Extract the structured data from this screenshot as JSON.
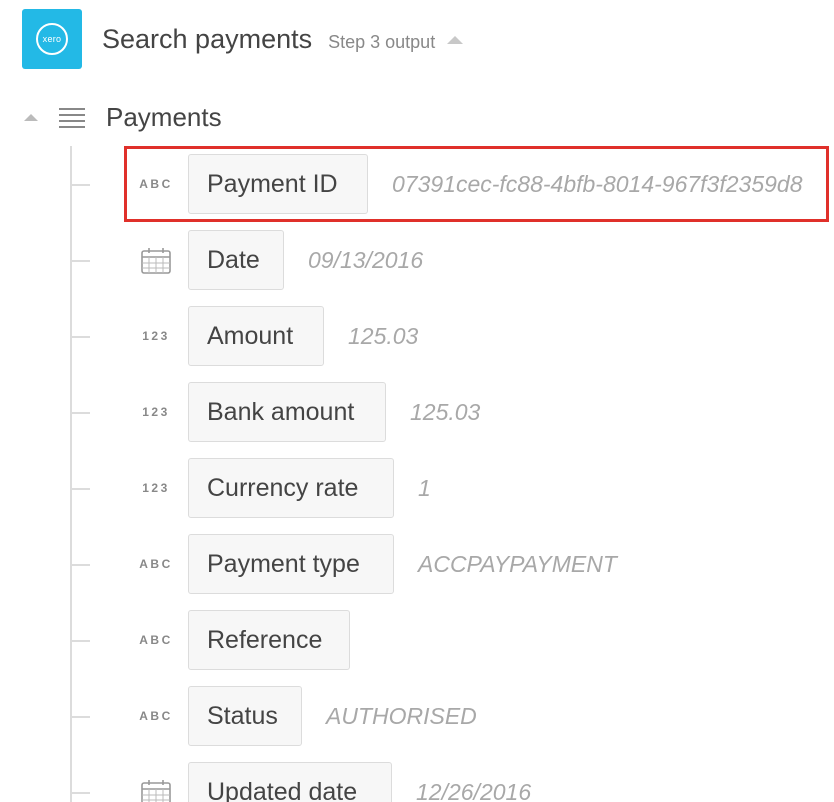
{
  "header": {
    "logo_text": "xero",
    "title": "Search payments",
    "subtitle": "Step 3 output"
  },
  "section": {
    "title": "Payments"
  },
  "fields": [
    {
      "type": "ABC",
      "label": "Payment ID",
      "value": "07391cec-fc88-4bfb-8014-967f3f2359d8"
    },
    {
      "type": "date",
      "label": "Date",
      "value": "09/13/2016"
    },
    {
      "type": "123",
      "label": "Amount",
      "value": "125.03"
    },
    {
      "type": "123",
      "label": "Bank amount",
      "value": "125.03"
    },
    {
      "type": "123",
      "label": "Currency rate",
      "value": "1"
    },
    {
      "type": "ABC",
      "label": "Payment type",
      "value": "ACCPAYPAYMENT"
    },
    {
      "type": "ABC",
      "label": "Reference",
      "value": ""
    },
    {
      "type": "ABC",
      "label": "Status",
      "value": "AUTHORISED"
    },
    {
      "type": "date",
      "label": "Updated date",
      "value": "12/26/2016"
    }
  ],
  "colors": {
    "brand": "#23b9e6",
    "highlight": "#e0302a"
  }
}
